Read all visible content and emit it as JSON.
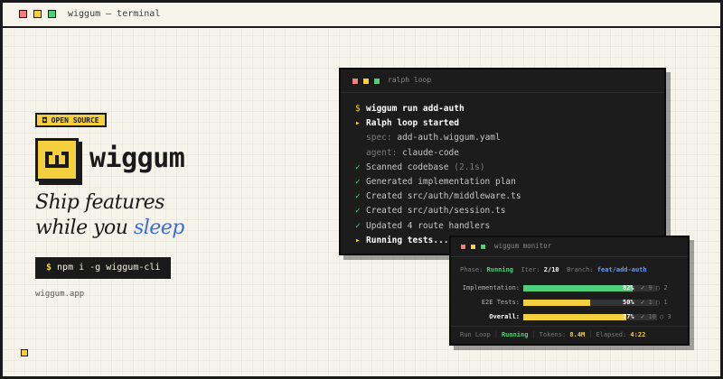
{
  "window": {
    "title": "wiggum — terminal"
  },
  "colors": {
    "accent": "#f4d03f",
    "blue": "#3b6fd4",
    "green": "#4ed07a",
    "red": "#f07f7f",
    "dark": "#1a1a1a"
  },
  "hero": {
    "badge": "◘ OPEN SOURCE",
    "brand": "wiggum",
    "tagline_line1": "Ship features",
    "tagline_line2_start": "while you",
    "tagline_line2_accent": "sleep",
    "install_prompt": "$",
    "install_cmd": "npm i -g wiggum-cli",
    "site": "wiggum.app"
  },
  "terminal": {
    "title": "ralph loop",
    "lines": [
      {
        "prefix": "$",
        "text": "wiggum run add-auth",
        "prefix_style": "yel",
        "text_style": "cmd"
      },
      {
        "prefix": "▸",
        "text": "Ralph loop started",
        "prefix_style": "yel",
        "text_style": "wht"
      },
      {
        "prefix": "",
        "label": "spec:",
        "text": "add-auth.wiggum.yaml"
      },
      {
        "prefix": "",
        "label": "agent:",
        "text": "claude-code"
      },
      {
        "prefix": "✓",
        "text": "Scanned codebase",
        "extra": "(2.1s)",
        "prefix_style": "grn"
      },
      {
        "prefix": "✓",
        "text": "Generated implementation plan",
        "prefix_style": "grn"
      },
      {
        "prefix": "✓",
        "text": "Created src/auth/middleware.ts",
        "prefix_style": "grn"
      },
      {
        "prefix": "✓",
        "text": "Created src/auth/session.ts",
        "prefix_style": "grn"
      },
      {
        "prefix": "✓",
        "text": "Updated 4 route handlers",
        "prefix_style": "grn"
      },
      {
        "prefix": "▸",
        "text": "Running tests...",
        "prefix_style": "yel",
        "text_style": "wht"
      }
    ]
  },
  "monitor": {
    "title": "wiggum monitor",
    "phase_label": "Phase:",
    "phase_value": "Running",
    "iter_label": "Iter:",
    "iter_value": "2/10",
    "branch_label": "Branch:",
    "branch_value": "feat/add-auth",
    "rows": [
      {
        "label": "Implementation:",
        "percent": 82,
        "pct_text": "82%",
        "done": "9",
        "pending": "2",
        "color": "#4ed07a"
      },
      {
        "label": "E2E Tests:",
        "percent": 50,
        "pct_text": "50%",
        "done": "1",
        "pending": "1",
        "color": "#f4d03f"
      },
      {
        "label": "Overall:",
        "percent": 77,
        "pct_text": "77%",
        "done": "10",
        "pending": "3",
        "color": "#f4d03f"
      }
    ],
    "footer": {
      "loop_label": "Run Loop",
      "loop_value": "Running",
      "tokens_label": "Tokens:",
      "tokens_value": "8.4M",
      "elapsed_label": "Elapsed:",
      "elapsed_value": "4:22"
    }
  }
}
